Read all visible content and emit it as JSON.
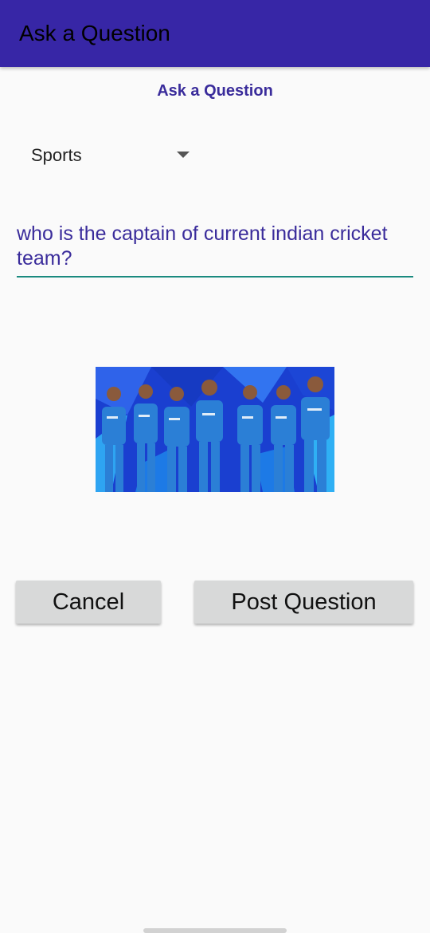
{
  "app_bar": {
    "title": "Ask a Question",
    "color": "#3726a6"
  },
  "form": {
    "heading": "Ask a Question",
    "category_spinner": {
      "selected": "Sports",
      "icon": "dropdown-arrow-icon"
    },
    "question_field": {
      "value": "who is the captain of current indian cricket team?"
    },
    "attached_image": {
      "subject": "indian-cricket-team-photo"
    }
  },
  "buttons": {
    "cancel_label": "Cancel",
    "post_label": "Post Question"
  },
  "colors": {
    "accent": "#3a2c9b",
    "underline": "#1a8a7f",
    "button_bg": "#d8d9d9",
    "background": "#fafafa"
  }
}
